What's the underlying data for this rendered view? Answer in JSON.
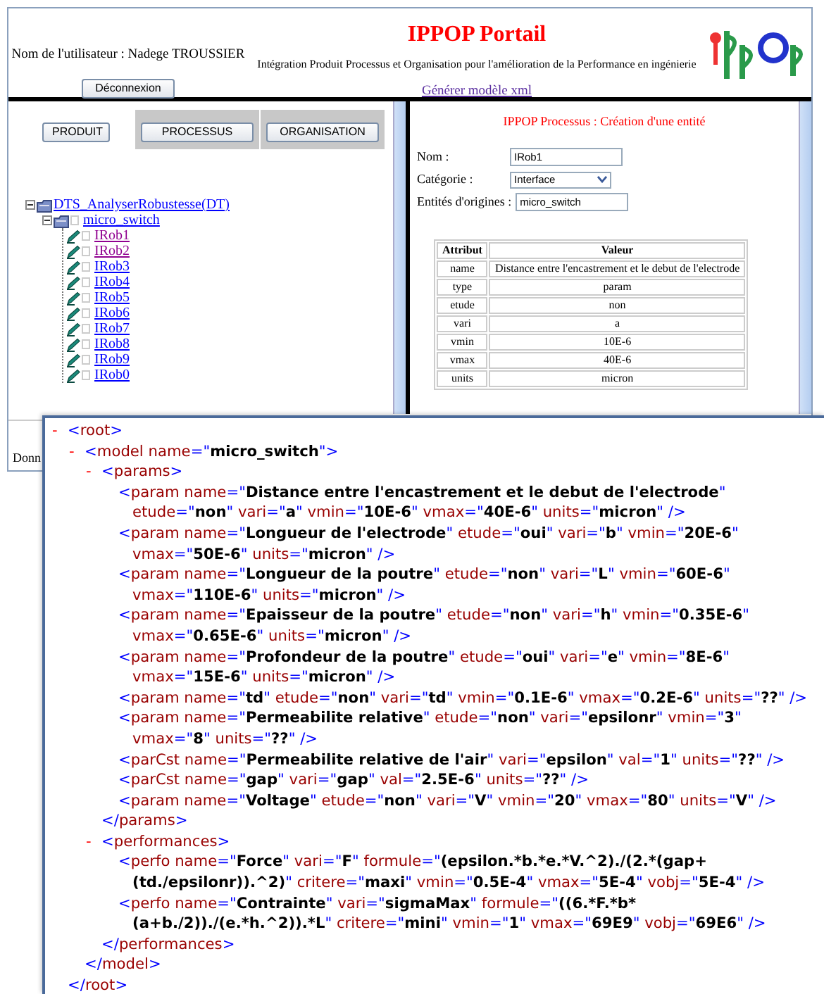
{
  "header": {
    "user_label": "Nom de l'utilisateur : Nadege TROUSSIER",
    "logout_button": "Déconnexion",
    "title": "IPPOP Portail",
    "subtitle": "Intégration Produit Processus et Organisation pour l'amélioration de la Performance en ingénierie",
    "xml_link": "Générer modèle xml"
  },
  "left_panel": {
    "buttons": [
      {
        "label": "PRODUIT",
        "shaded": false
      },
      {
        "label": "PROCESSUS",
        "shaded": true
      },
      {
        "label": "ORGANISATION",
        "shaded": true
      }
    ],
    "tree": [
      {
        "label": "DTS_AnalyserRobustesse(DT)",
        "expanded": true,
        "visited": false,
        "children": [
          {
            "label": "micro_switch",
            "expanded": true,
            "visited": false,
            "checked": false,
            "children": [
              {
                "label": "IRob1",
                "visited": true,
                "checked": false
              },
              {
                "label": "IRob2",
                "visited": true,
                "checked": false
              },
              {
                "label": "IRob3",
                "visited": false,
                "checked": false
              },
              {
                "label": "IRob4",
                "visited": false,
                "checked": false
              },
              {
                "label": "IRob5",
                "visited": false,
                "checked": false
              },
              {
                "label": "IRob6",
                "visited": false,
                "checked": false
              },
              {
                "label": "IRob7",
                "visited": false,
                "checked": false
              },
              {
                "label": "IRob8",
                "visited": false,
                "checked": false
              },
              {
                "label": "IRob9",
                "visited": false,
                "checked": false
              },
              {
                "label": "IRob0",
                "visited": false,
                "checked": false
              }
            ]
          }
        ]
      }
    ],
    "footer_text": "Donn"
  },
  "right_panel": {
    "title": "IPPOP Processus : Création d'une entité",
    "fields": [
      {
        "kind": "text",
        "label": "Nom :",
        "value": "IRob1"
      },
      {
        "kind": "select",
        "label": "Catégorie :",
        "value": "Interface"
      },
      {
        "kind": "text",
        "label": "Entités d'origines :",
        "value": "micro_switch"
      }
    ],
    "table": {
      "columns": [
        "Attribut",
        "Valeur"
      ],
      "rows": [
        [
          "name",
          "Distance entre l'encastrement et le debut de l'electrode"
        ],
        [
          "type",
          "param"
        ],
        [
          "etude",
          "non"
        ],
        [
          "vari",
          "a"
        ],
        [
          "vmin",
          "10E-6"
        ],
        [
          "vmax",
          "40E-6"
        ],
        [
          "units",
          "micron"
        ]
      ]
    }
  },
  "xml_viewer": {
    "syntax": {
      "lt": "<",
      "gt": ">",
      "end": "</",
      "self_close": "/>",
      "eq": "=",
      "quote": "\""
    },
    "root": {
      "toggle": "-",
      "expanded": true,
      "tag": "root",
      "close_tag": "root",
      "children": [
        {
          "toggle": "-",
          "expanded": true,
          "tag": "model",
          "close_tag": "model",
          "attrs": [
            [
              "name",
              "micro_switch"
            ]
          ],
          "children": [
            {
              "toggle": "-",
              "expanded": true,
              "tag": "params",
              "close_tag": "params",
              "children": [
                {
                  "tag": "param",
                  "attrs": [
                    [
                      "name",
                      "Distance entre l'encastrement et le debut de l'electrode"
                    ],
                    [
                      "etude",
                      "non"
                    ],
                    [
                      "vari",
                      "a"
                    ],
                    [
                      "vmin",
                      "10E-6"
                    ],
                    [
                      "vmax",
                      "40E-6"
                    ],
                    [
                      "units",
                      "micron"
                    ]
                  ]
                },
                {
                  "tag": "param",
                  "attrs": [
                    [
                      "name",
                      "Longueur de l'electrode"
                    ],
                    [
                      "etude",
                      "oui"
                    ],
                    [
                      "vari",
                      "b"
                    ],
                    [
                      "vmin",
                      "20E-6"
                    ],
                    [
                      "vmax",
                      "50E-6"
                    ],
                    [
                      "units",
                      "micron"
                    ]
                  ]
                },
                {
                  "tag": "param",
                  "attrs": [
                    [
                      "name",
                      "Longueur de la poutre"
                    ],
                    [
                      "etude",
                      "non"
                    ],
                    [
                      "vari",
                      "L"
                    ],
                    [
                      "vmin",
                      "60E-6"
                    ],
                    [
                      "vmax",
                      "110E-6"
                    ],
                    [
                      "units",
                      "micron"
                    ]
                  ]
                },
                {
                  "tag": "param",
                  "attrs": [
                    [
                      "name",
                      "Epaisseur de la poutre"
                    ],
                    [
                      "etude",
                      "non"
                    ],
                    [
                      "vari",
                      "h"
                    ],
                    [
                      "vmin",
                      "0.35E-6"
                    ],
                    [
                      "vmax",
                      "0.65E-6"
                    ],
                    [
                      "units",
                      "micron"
                    ]
                  ]
                },
                {
                  "tag": "param",
                  "attrs": [
                    [
                      "name",
                      "Profondeur de la poutre"
                    ],
                    [
                      "etude",
                      "oui"
                    ],
                    [
                      "vari",
                      "e"
                    ],
                    [
                      "vmin",
                      "8E-6"
                    ],
                    [
                      "vmax",
                      "15E-6"
                    ],
                    [
                      "units",
                      "micron"
                    ]
                  ]
                },
                {
                  "tag": "param",
                  "attrs": [
                    [
                      "name",
                      "td"
                    ],
                    [
                      "etude",
                      "non"
                    ],
                    [
                      "vari",
                      "td"
                    ],
                    [
                      "vmin",
                      "0.1E-6"
                    ],
                    [
                      "vmax",
                      "0.2E-6"
                    ],
                    [
                      "units",
                      "??"
                    ]
                  ]
                },
                {
                  "tag": "param",
                  "attrs": [
                    [
                      "name",
                      "Permeabilite relative"
                    ],
                    [
                      "etude",
                      "non"
                    ],
                    [
                      "vari",
                      "epsilonr"
                    ],
                    [
                      "vmin",
                      "3"
                    ],
                    [
                      "vmax",
                      "8"
                    ],
                    [
                      "units",
                      "??"
                    ]
                  ]
                },
                {
                  "tag": "parCst",
                  "attrs": [
                    [
                      "name",
                      "Permeabilite relative de l'air"
                    ],
                    [
                      "vari",
                      "epsilon"
                    ],
                    [
                      "val",
                      "1"
                    ],
                    [
                      "units",
                      "??"
                    ]
                  ]
                },
                {
                  "tag": "parCst",
                  "attrs": [
                    [
                      "name",
                      "gap"
                    ],
                    [
                      "vari",
                      "gap"
                    ],
                    [
                      "val",
                      "2.5E-6"
                    ],
                    [
                      "units",
                      "??"
                    ]
                  ]
                },
                {
                  "tag": "param",
                  "attrs": [
                    [
                      "name",
                      "Voltage"
                    ],
                    [
                      "etude",
                      "non"
                    ],
                    [
                      "vari",
                      "V"
                    ],
                    [
                      "vmin",
                      "20"
                    ],
                    [
                      "vmax",
                      "80"
                    ],
                    [
                      "units",
                      "V"
                    ]
                  ]
                }
              ]
            },
            {
              "toggle": "-",
              "expanded": true,
              "tag": "performances",
              "close_tag": "performances",
              "children": [
                {
                  "tag": "perfo",
                  "attrs": [
                    [
                      "name",
                      "Force"
                    ],
                    [
                      "vari",
                      "F"
                    ],
                    [
                      "formule",
                      "(epsilon.*b.*e.*V.^2)./(2.*(gap+(td./epsilonr)).^2)"
                    ],
                    [
                      "critere",
                      "maxi"
                    ],
                    [
                      "vmin",
                      "0.5E-4"
                    ],
                    [
                      "vmax",
                      "5E-4"
                    ],
                    [
                      "vobj",
                      "5E-4"
                    ]
                  ]
                },
                {
                  "tag": "perfo",
                  "attrs": [
                    [
                      "name",
                      "Contrainte"
                    ],
                    [
                      "vari",
                      "sigmaMax"
                    ],
                    [
                      "formule",
                      "((6.*F.*b*(a+b./2))./(e.*h.^2)).*L"
                    ],
                    [
                      "critere",
                      "mini"
                    ],
                    [
                      "vmin",
                      "1"
                    ],
                    [
                      "vmax",
                      "69E9"
                    ],
                    [
                      "vobj",
                      "69E6"
                    ]
                  ]
                }
              ]
            }
          ]
        }
      ]
    }
  }
}
